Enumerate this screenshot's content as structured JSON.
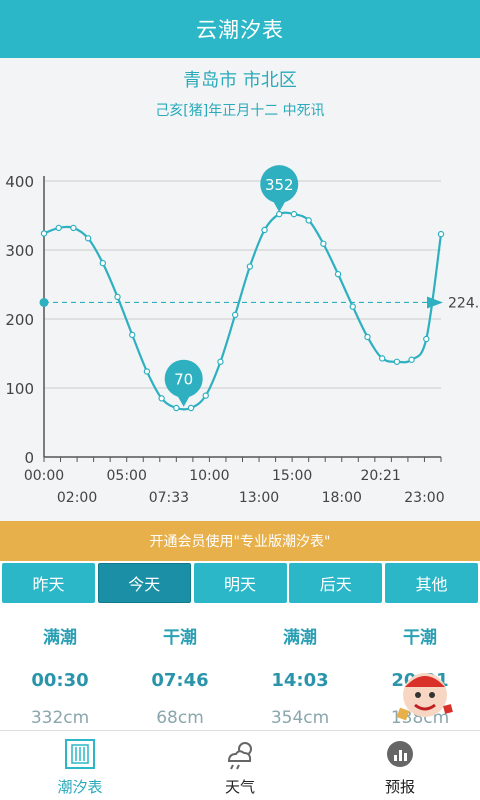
{
  "app": {
    "title": "云潮汐表"
  },
  "location": "青岛市 市北区",
  "lunar_date": "己亥[猪]年正月十二 中死讯",
  "chart_data": {
    "type": "line",
    "title": "",
    "xlabel": "",
    "ylabel": "",
    "ylim": [
      0,
      400
    ],
    "xlim": [
      0,
      24
    ],
    "yticks": [
      0,
      100,
      200,
      300,
      400
    ],
    "xticks_top": [
      "00:00",
      "05:00",
      "10:00",
      "15:00",
      "20:21"
    ],
    "xticks_top_hours": [
      0,
      5,
      10,
      15,
      20.35
    ],
    "xticks_bottom": [
      "02:00",
      "07:33",
      "13:00",
      "18:00",
      "23:00"
    ],
    "xticks_bottom_hours": [
      2,
      7.55,
      13,
      18,
      23
    ],
    "series": [
      {
        "points": [
          {
            "x": 0,
            "y": 324
          },
          {
            "x": 1,
            "y": 332
          },
          {
            "x": 2,
            "y": 332
          },
          {
            "x": 3,
            "y": 317
          },
          {
            "x": 4,
            "y": 281
          },
          {
            "x": 5,
            "y": 232
          },
          {
            "x": 6,
            "y": 177
          },
          {
            "x": 7,
            "y": 124
          },
          {
            "x": 8,
            "y": 85
          },
          {
            "x": 9,
            "y": 71
          },
          {
            "x": 10,
            "y": 71
          },
          {
            "x": 11,
            "y": 89
          },
          {
            "x": 12,
            "y": 138
          },
          {
            "x": 13,
            "y": 206
          },
          {
            "x": 14,
            "y": 276
          },
          {
            "x": 15,
            "y": 329
          },
          {
            "x": 16,
            "y": 352
          },
          {
            "x": 17,
            "y": 352
          },
          {
            "x": 18,
            "y": 343
          },
          {
            "x": 19,
            "y": 309
          },
          {
            "x": 20,
            "y": 265
          },
          {
            "x": 21,
            "y": 218
          },
          {
            "x": 22,
            "y": 174
          },
          {
            "x": 23,
            "y": 143
          },
          {
            "x": 24,
            "y": 138
          },
          {
            "x": 25,
            "y": 141
          },
          {
            "x": 26,
            "y": 171
          },
          {
            "x": 27,
            "y": 323
          }
        ],
        "x_units": "sample index (about 0.85 h apart)"
      }
    ],
    "markers": [
      {
        "label": "352",
        "x": 16,
        "y": 352
      },
      {
        "label": "70",
        "x": 9.5,
        "y": 70
      }
    ],
    "current_level": {
      "value": 224,
      "label": "224."
    },
    "grid": true,
    "colors": {
      "line": "#2eb0c0",
      "grid": "#cccccc",
      "axis": "#555555",
      "marker": "#2eb0c0"
    }
  },
  "banner": {
    "text": "开通会员使用\"专业版潮汐表\""
  },
  "tabs": [
    {
      "label": "昨天",
      "active": false
    },
    {
      "label": "今天",
      "active": true
    },
    {
      "label": "明天",
      "active": false
    },
    {
      "label": "后天",
      "active": false
    },
    {
      "label": "其他",
      "active": false
    }
  ],
  "tides": [
    {
      "type": "满潮",
      "time": "00:30",
      "height": "332cm"
    },
    {
      "type": "干潮",
      "time": "07:46",
      "height": "68cm"
    },
    {
      "type": "满潮",
      "time": "14:03",
      "height": "354cm"
    },
    {
      "type": "干潮",
      "time": "20:21",
      "height": "138cm"
    }
  ],
  "nav": [
    {
      "label": "潮汐表",
      "icon": "tide-table-icon",
      "active": true
    },
    {
      "label": "天气",
      "icon": "weather-icon",
      "active": false
    },
    {
      "label": "预报",
      "icon": "forecast-icon",
      "active": false
    }
  ],
  "colors": {
    "primary": "#2bb7c8",
    "primary_dark": "#1a8fa5",
    "banner": "#e8b04a"
  }
}
